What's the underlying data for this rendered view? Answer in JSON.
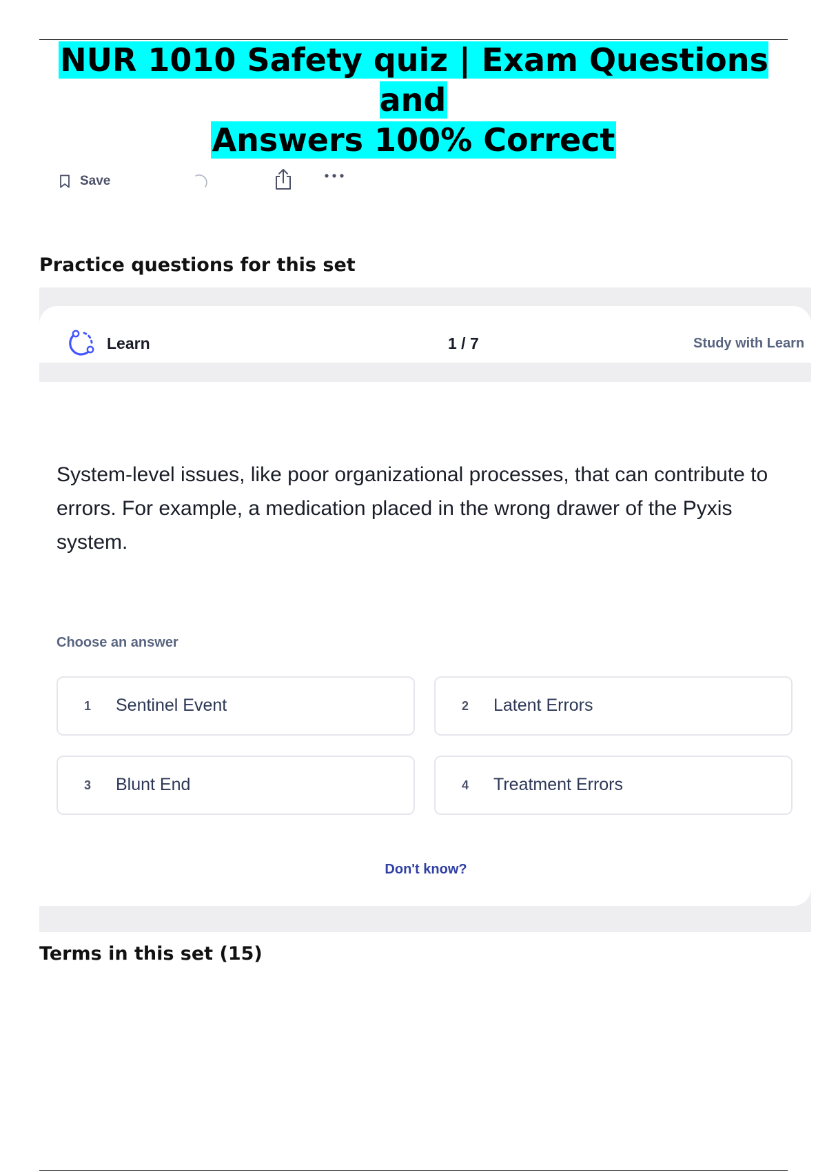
{
  "document": {
    "title_line1": "NUR 1010 Safety quiz | Exam Questions and",
    "title_line2": "Answers 100% Correct",
    "highlight_color": "#00ffff"
  },
  "toolbar": {
    "save_label": "Save",
    "icons": [
      "bookmark-icon",
      "loading-spinner-icon",
      "share-icon",
      "more-options-icon"
    ]
  },
  "practice_section": {
    "heading": "Practice questions for this set"
  },
  "learn_card": {
    "mode_label": "Learn",
    "progress": "1 / 7",
    "study_link": "Study with Learn",
    "question": "System-level issues, like poor organizational processes, that can contribute to errors. For example, a medication placed in the wrong drawer of the Pyxis system.",
    "choose_label": "Choose an answer",
    "options": [
      {
        "number": "1",
        "label": "Sentinel Event"
      },
      {
        "number": "2",
        "label": "Latent Errors"
      },
      {
        "number": "3",
        "label": "Blunt End"
      },
      {
        "number": "4",
        "label": "Treatment Errors"
      }
    ],
    "dont_know": "Don't know?",
    "accent_color": "#4255ff"
  },
  "terms_section": {
    "heading": "Terms in this set (15)"
  }
}
